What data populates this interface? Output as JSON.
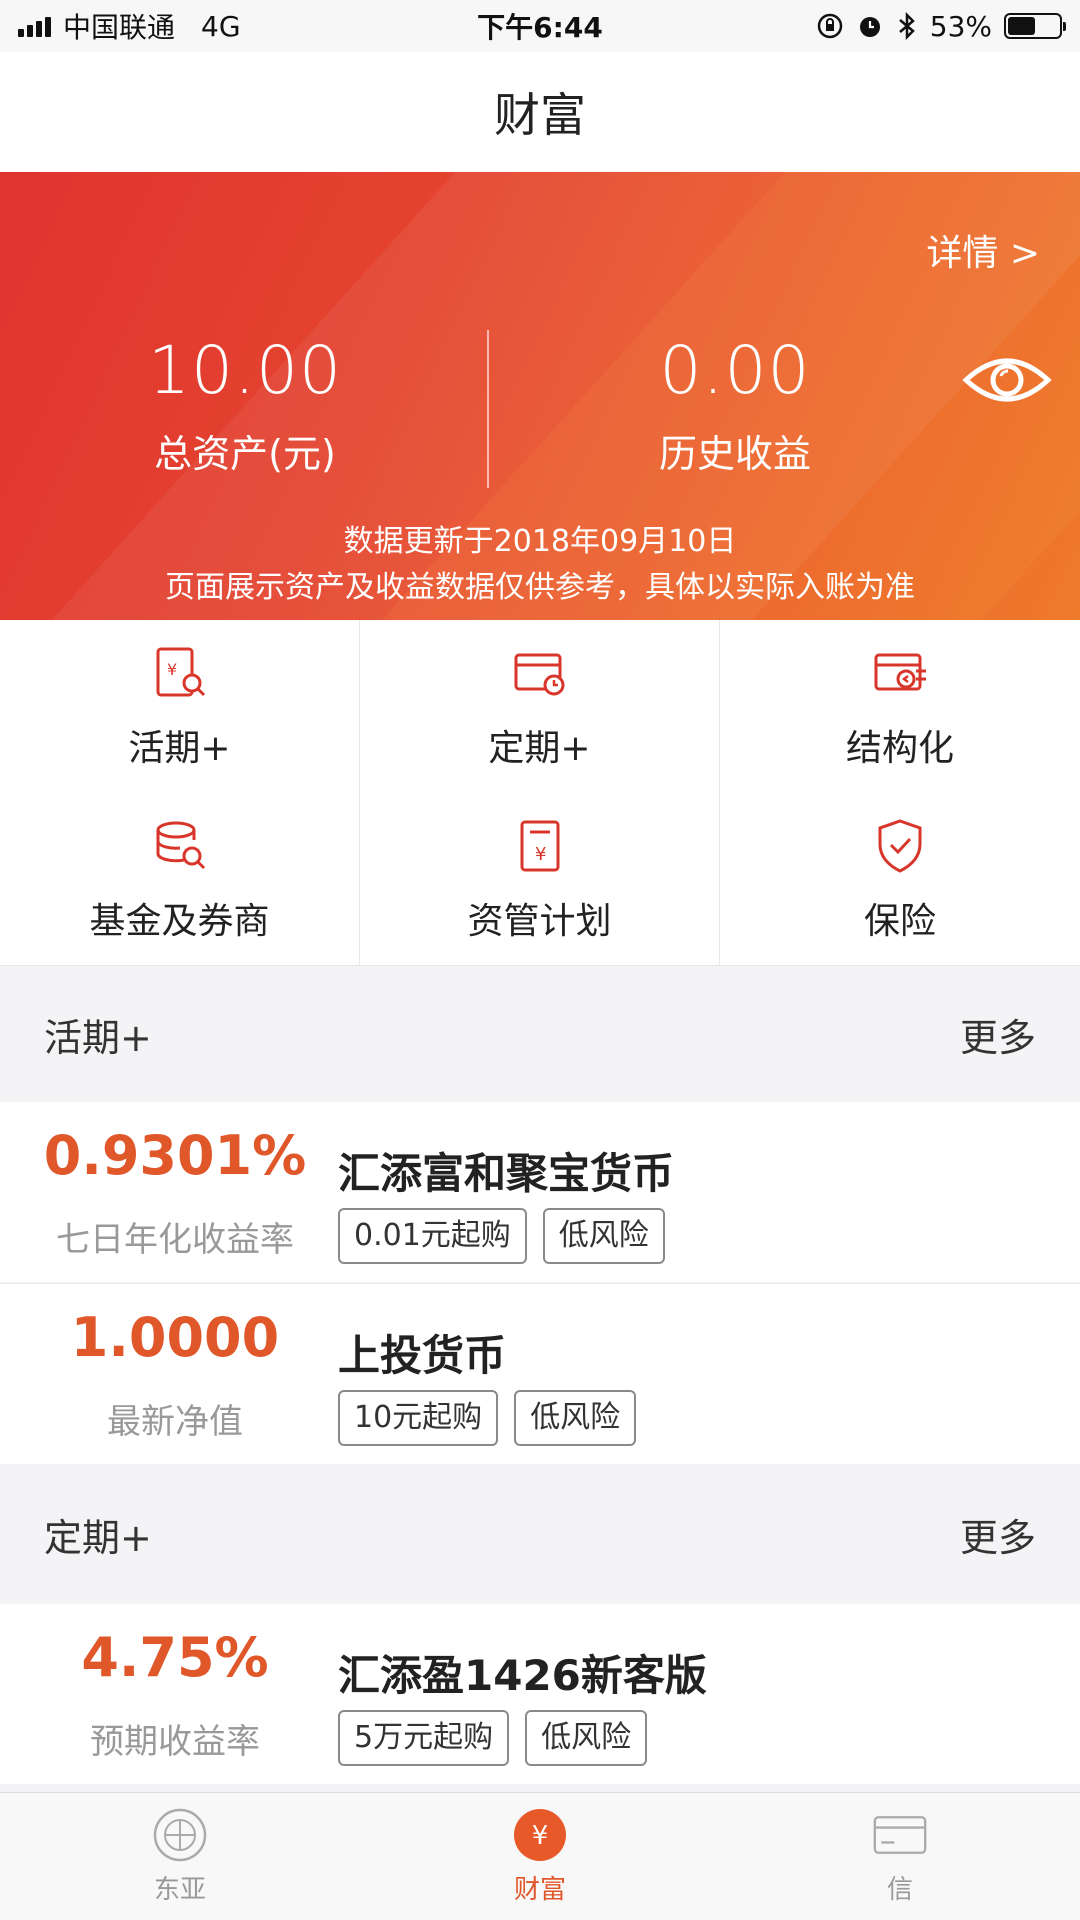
{
  "status_bar": {
    "carrier": "中国联通",
    "network": "4G",
    "time": "下午6:44",
    "battery": "53%",
    "battery_level": 0.53
  },
  "header": {
    "title": "财富"
  },
  "summary": {
    "detail_link": "详情 >",
    "total_assets_value": "10.00",
    "total_assets_label": "总资产(元)",
    "history_income_value": "0.00",
    "history_income_label": "历史收益",
    "update_note": "数据更新于2018年09月10日",
    "disclaimer": "页面展示资产及收益数据仅供参考，具体以实际入账为准"
  },
  "categories": [
    {
      "label": "活期+",
      "icon": "demand-deposit-icon"
    },
    {
      "label": "定期+",
      "icon": "fixed-term-icon"
    },
    {
      "label": "结构化",
      "icon": "structured-icon"
    },
    {
      "label": "基金及券商",
      "icon": "fund-icon"
    },
    {
      "label": "资管计划",
      "icon": "asset-plan-icon"
    },
    {
      "label": "保险",
      "icon": "insurance-icon"
    }
  ],
  "sections": [
    {
      "title": "活期+",
      "more": "更多",
      "products": [
        {
          "rate": "0.9301%",
          "rate_label": "七日年化收益率",
          "name": "汇添富和聚宝货币",
          "tags": [
            "0.01元起购",
            "低风险"
          ]
        },
        {
          "rate": "1.0000",
          "rate_label": "最新净值",
          "name": "上投货币",
          "tags": [
            "10元起购",
            "低风险"
          ]
        }
      ]
    },
    {
      "title": "定期+",
      "more": "更多",
      "products": [
        {
          "rate": "4.75%",
          "rate_label": "预期收益率",
          "name": "汇添盈1426新客版",
          "tags": [
            "5万元起购",
            "低风险"
          ]
        }
      ]
    }
  ],
  "tab_bar": [
    {
      "label": "东亚",
      "icon": "bank-globe-icon",
      "active": false
    },
    {
      "label": "财富",
      "icon": "yen-coin-icon",
      "active": true
    },
    {
      "label": "信",
      "icon": "credit-card-icon",
      "active": false
    }
  ],
  "colors": {
    "accent": "#e0572a",
    "hero_start": "#e0342f",
    "hero_end": "#ee7a2c"
  }
}
